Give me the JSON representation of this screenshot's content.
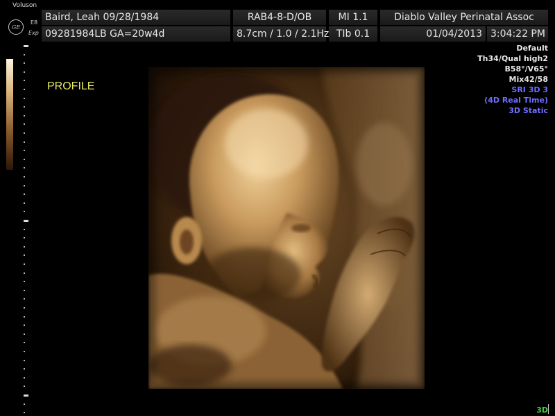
{
  "header": {
    "brand": "Voluson",
    "logo_text": "GE",
    "model": "E8",
    "model_suffix": "Exp",
    "patient_name": "Baird, Leah 09/28/1984",
    "probe_preset": "RAB4-8-D/OB",
    "mi": "MI 1.1",
    "institution": "Diablo Valley Perinatal Assoc",
    "patient_id_ga": "09281984LB GA=20w4d",
    "depth_freq": "8.7cm / 1.0 / 2.1Hz",
    "tib": "TIb 0.1",
    "date": "01/04/2013",
    "time": "3:04:22 PM"
  },
  "annotations": {
    "profile": "PROFILE"
  },
  "params": {
    "p1": "Default",
    "p2": "Th34/Qual high2",
    "p3": "B58°/V65°",
    "p4": "Mix42/58",
    "p5": "SRI 3D 3",
    "p6": "(4D Real Time)",
    "p7": "3D Static"
  },
  "mode_tag": "3D",
  "colors": {
    "background": "#000000",
    "header_cell": "#222222",
    "annotation_yellow": "#e8e860",
    "param_blue": "#6f6fff",
    "mode_green": "#3fcf3f",
    "render_sepia": "#a67c48"
  }
}
